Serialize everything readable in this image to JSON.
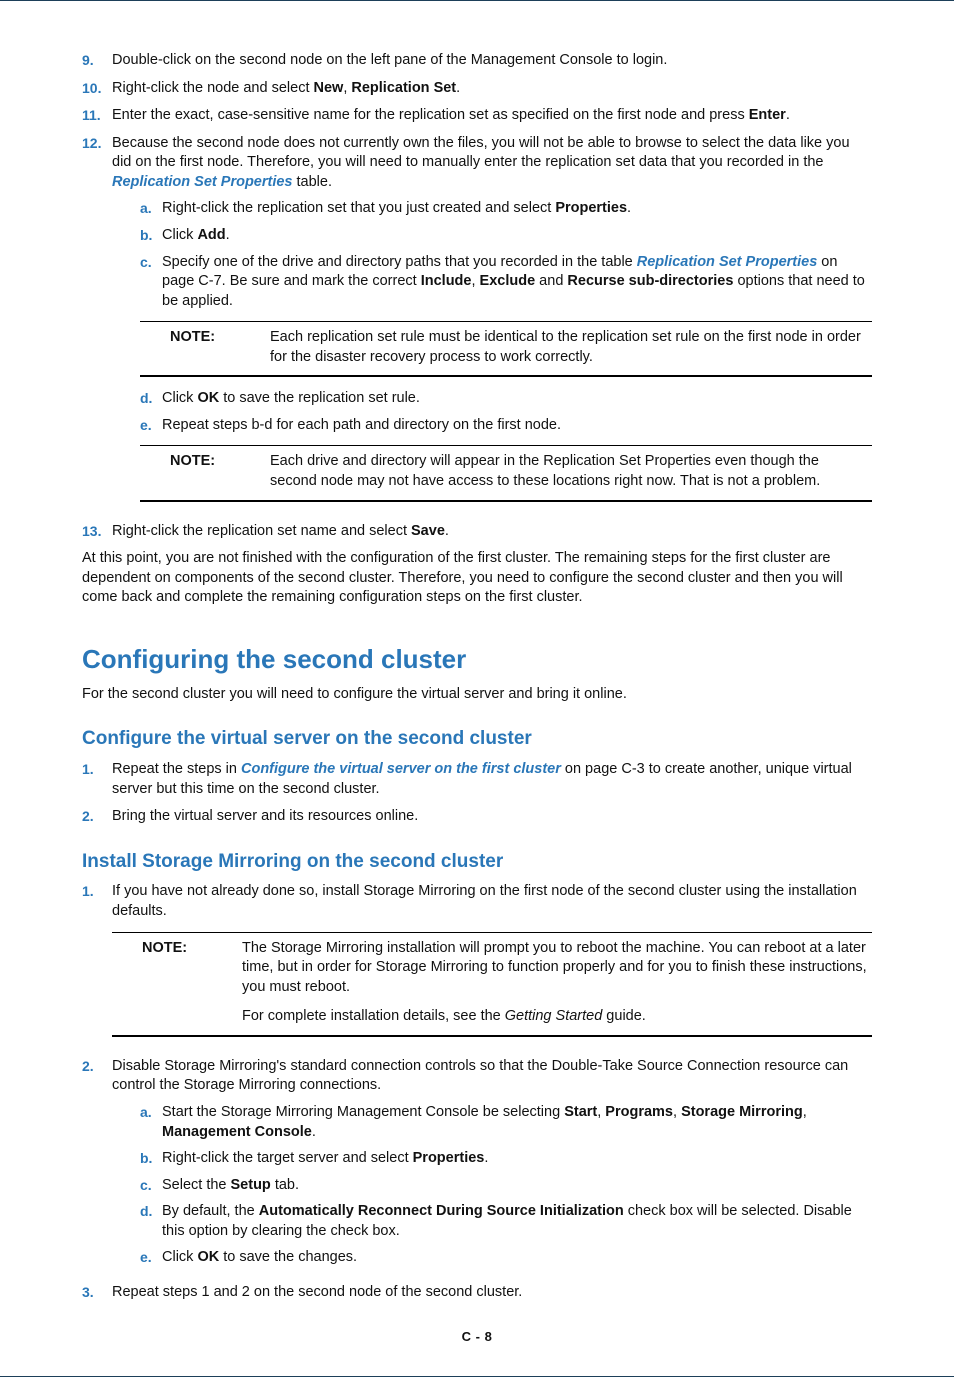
{
  "steps": {
    "s9": "Double-click on the second node on the left pane of the Management Console to login.",
    "s10_pre": "Right-click the node and select ",
    "s10_b1": "New",
    "s10_mid": ", ",
    "s10_b2": "Replication Set",
    "s10_post": ".",
    "s11_pre": "Enter the exact, case-sensitive name for the replication set as specified on the first node and press ",
    "s11_b": "Enter",
    "s11_post": ".",
    "s12_pre": "Because the second node does not currently own the files, you will not be able to browse to select the data like you did on the first node. Therefore, you will need to manually enter the replication set data that you recorded in the ",
    "s12_link": "Replication Set Properties",
    "s12_post": " table.",
    "s12a_pre": "Right-click the replication set that you just created and select ",
    "s12a_b": "Properties",
    "s12a_post": ".",
    "s12b_pre": "Click ",
    "s12b_b": "Add",
    "s12b_post": ".",
    "s12c_pre": "Specify one of the drive and directory paths that you recorded in the table ",
    "s12c_link": "Replication Set Properties",
    "s12c_mid": " on page C-7. Be sure and mark the correct ",
    "s12c_b1": "Include",
    "s12c_c1": ", ",
    "s12c_b2": "Exclude",
    "s12c_c2": " and ",
    "s12c_b3": "Recurse sub-directories",
    "s12c_post": " options that need to be applied.",
    "note1_label": "NOTE:",
    "note1_body": "Each replication set rule must be identical to the replication set rule on the first node in order for the disaster recovery process to work correctly.",
    "s12d_pre": "Click ",
    "s12d_b": "OK",
    "s12d_post": " to save the replication set rule.",
    "s12e": "Repeat steps b-d for each path and directory on the first node.",
    "note2_label": "NOTE:",
    "note2_body": "Each drive and directory will appear in the Replication Set Properties even though the second node may not have access to these locations right now. That is not a problem.",
    "s13_pre": "Right-click the replication set name and select ",
    "s13_b": "Save",
    "s13_post": "."
  },
  "closing_para": "At this point, you are not finished with the configuration of the first cluster. The remaining steps for the first cluster are dependent on components of the second cluster. Therefore, you need to configure the second cluster and then you will come back and complete the remaining configuration steps on the first cluster.",
  "h1": "Configuring the second cluster",
  "h1_intro": "For the second cluster you will need to configure the virtual server and bring it online.",
  "h2a": "Configure the virtual server on the second cluster",
  "a1_pre": "Repeat the steps in ",
  "a1_link": "Configure the virtual server on the first cluster",
  "a1_post": " on page C-3 to create another, unique virtual server but this time on the second cluster.",
  "a2": "Bring the virtual server and its resources online.",
  "h2b": "Install Storage Mirroring on the second cluster",
  "b1": "If you have not already done so, install Storage Mirroring on the first node of the second cluster using the installation defaults.",
  "note3_label": "NOTE:",
  "note3_p1": "The Storage Mirroring installation will prompt you to reboot the machine. You can reboot at a later time, but in order for Storage Mirroring to function properly and for you to finish these instructions, you must reboot.",
  "note3_p2_pre": "For complete installation details, see the ",
  "note3_p2_i": "Getting Started",
  "note3_p2_post": " guide.",
  "b2": "Disable Storage Mirroring's standard connection controls so that the Double-Take Source Connection resource can control the Storage Mirroring connections.",
  "b2a_pre": "Start the Storage Mirroring Management Console be selecting ",
  "b2a_b1": "Start",
  "b2a_c1": ", ",
  "b2a_b2": "Programs",
  "b2a_c2": ", ",
  "b2a_b3": "Storage Mirroring",
  "b2a_c3": ", ",
  "b2a_b4": "Management Console",
  "b2a_post": ".",
  "b2b_pre": "Right-click the target server and select ",
  "b2b_b": "Properties",
  "b2b_post": ".",
  "b2c_pre": "Select the ",
  "b2c_b": "Setup",
  "b2c_post": " tab.",
  "b2d_pre": "By default, the ",
  "b2d_b": "Automatically Reconnect During Source Initialization",
  "b2d_post": " check box will be selected. Disable this option by clearing the check box.",
  "b2e_pre": "Click ",
  "b2e_b": "OK",
  "b2e_post": " to save the changes.",
  "b3": "Repeat steps 1 and 2 on the second node of the second cluster.",
  "footer": "C - 8"
}
